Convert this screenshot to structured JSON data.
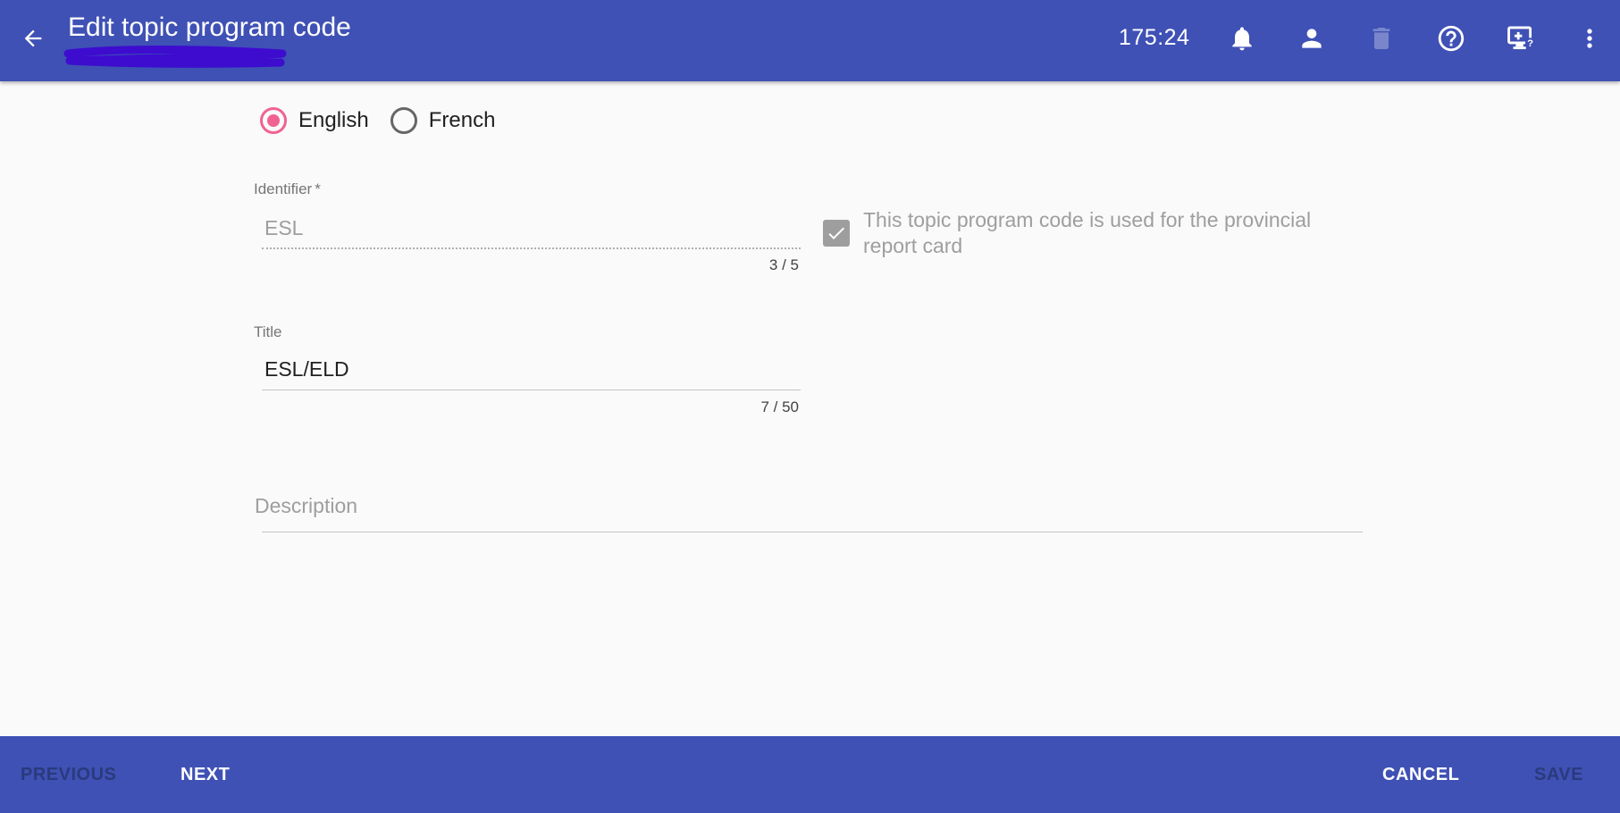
{
  "header": {
    "title": "Edit topic program code",
    "timer": "175:24",
    "icons": [
      "back-arrow-icon",
      "bell-icon",
      "person-icon",
      "trash-icon",
      "help-icon",
      "screen-help-icon",
      "more-vert-icon"
    ],
    "bar_color": "#3f51b5"
  },
  "language": {
    "options": [
      {
        "label": "English",
        "selected": true
      },
      {
        "label": "French",
        "selected": false
      }
    ],
    "accent_color": "#f06292"
  },
  "form": {
    "identifier": {
      "label": "Identifier",
      "required_marker": "*",
      "value": "ESL",
      "counter": "3 / 5",
      "disabled": true
    },
    "provincial_checkbox": {
      "label": "This topic program code is used for the provincial report card",
      "checked": true,
      "disabled": true
    },
    "title": {
      "label": "Title",
      "value": "ESL/ELD",
      "counter": "7 / 50"
    },
    "description": {
      "placeholder": "Description",
      "value": ""
    }
  },
  "footer": {
    "previous_label": "PREVIOUS",
    "next_label": "NEXT",
    "cancel_label": "CANCEL",
    "save_label": "SAVE"
  }
}
